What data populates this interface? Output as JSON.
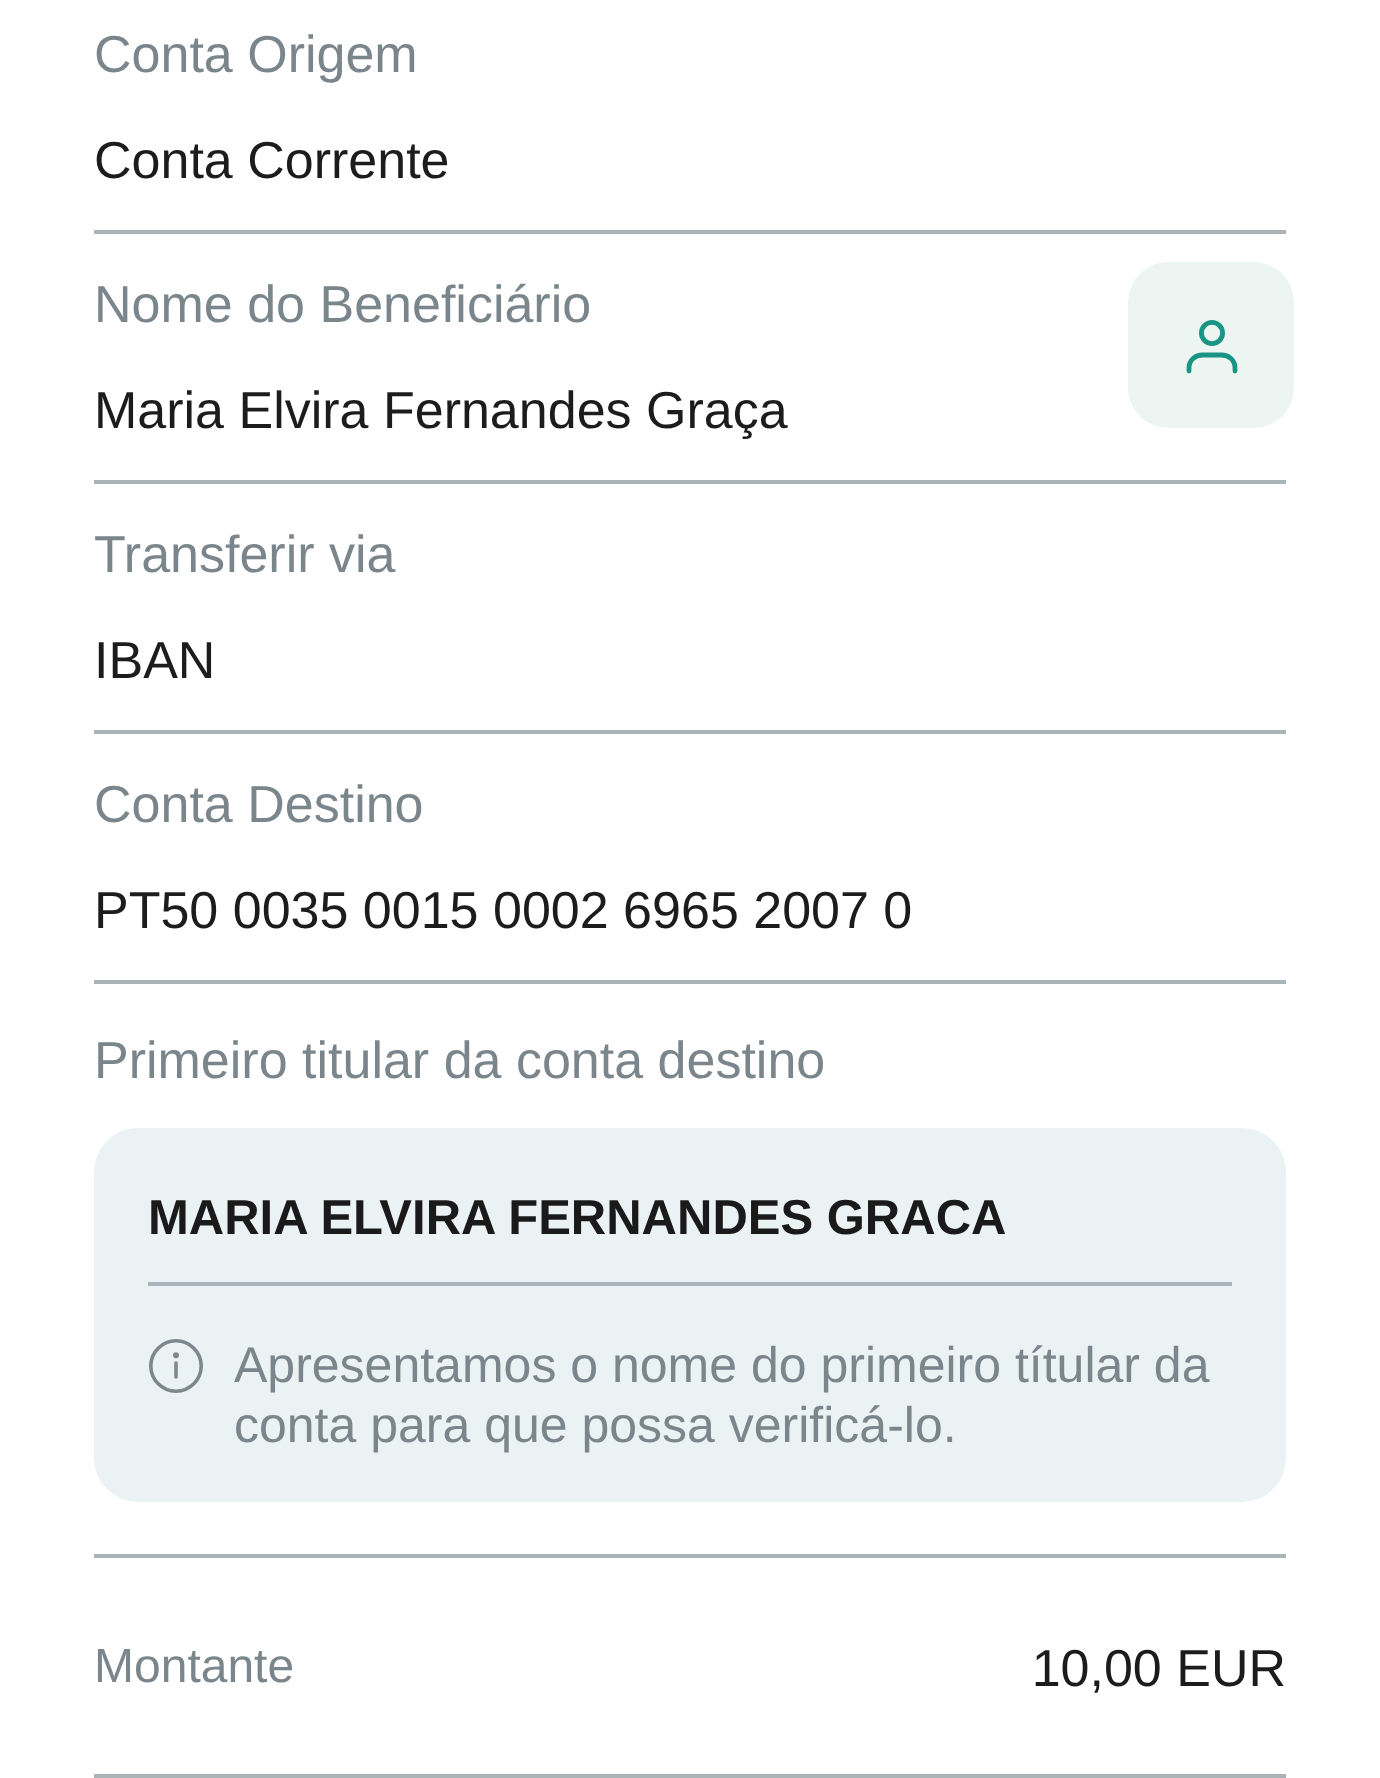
{
  "fields": [
    {
      "label": "Conta Origem",
      "value": "Conta Corrente",
      "contact_button": false
    },
    {
      "label": "Nome do Beneficiário",
      "value": "Maria Elvira Fernandes Graça",
      "contact_button": true
    },
    {
      "label": "Transferir via",
      "value": "IBAN",
      "contact_button": false
    },
    {
      "label": "Conta Destino",
      "value": "PT50 0035 0015 0002 6965 2007 0",
      "contact_button": false
    }
  ],
  "account_holder": {
    "label": "Primeiro titular da conta destino",
    "name": "MARIA ELVIRA FERNANDES GRACA",
    "note": "Apresentamos o nome do primeiro títular da conta para que possa verificá-lo."
  },
  "amount": {
    "label": "Montante",
    "value": "10,00 EUR"
  }
}
